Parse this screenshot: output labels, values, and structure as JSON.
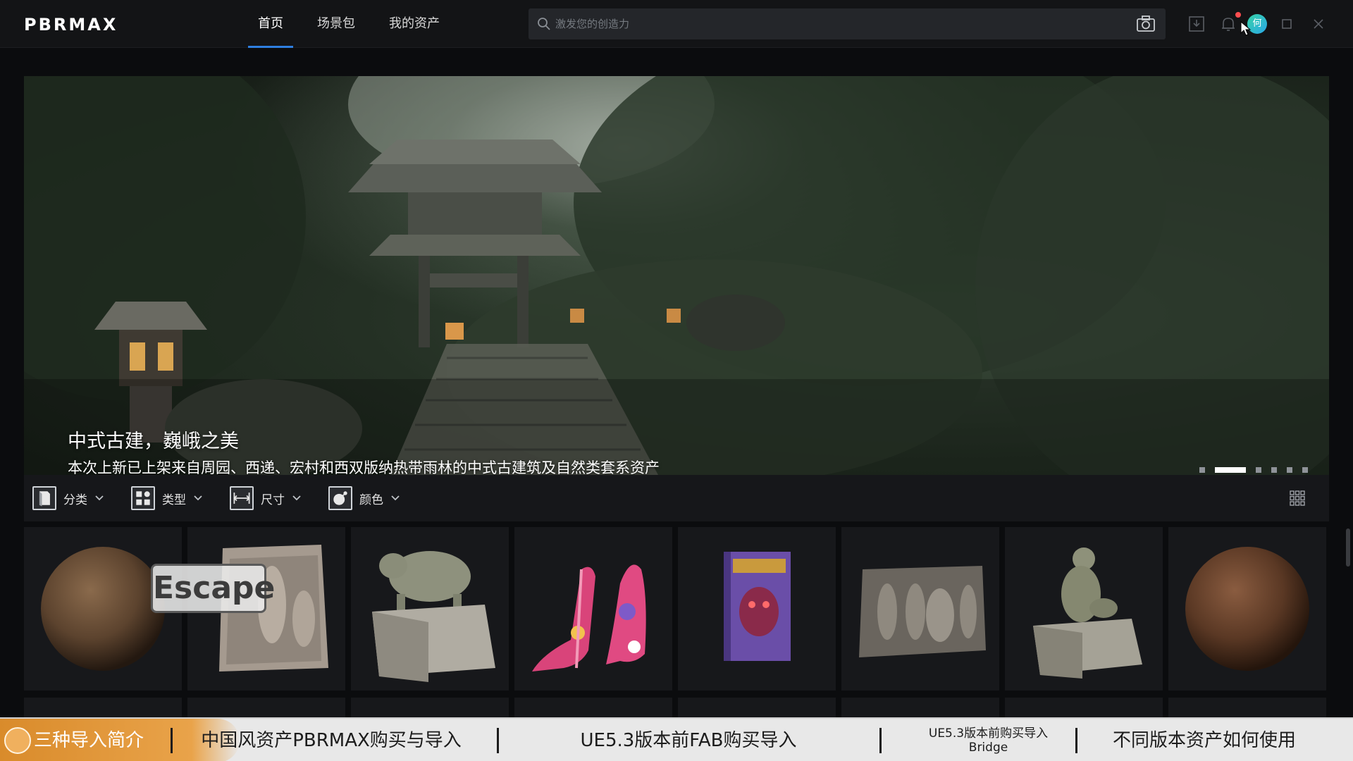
{
  "app": {
    "logo_text": "PBRMAX"
  },
  "nav": {
    "items": [
      {
        "label": "首页",
        "active": true
      },
      {
        "label": "场景包",
        "active": false
      },
      {
        "label": "我的资产",
        "active": false
      }
    ]
  },
  "search": {
    "placeholder": "激发您的创造力",
    "value": ""
  },
  "user": {
    "avatar_text": "何"
  },
  "banner": {
    "title": "中式古建，巍峨之美",
    "subtitle": "本次上新已上架来自周园、西递、宏村和西双版纳热带雨林的中式古建筑及自然类套系资产",
    "slide_count": 6,
    "active_slide": 2
  },
  "filters": [
    {
      "label": "分类",
      "icon": "book-icon"
    },
    {
      "label": "类型",
      "icon": "grid-type-icon"
    },
    {
      "label": "尺寸",
      "icon": "ruler-icon"
    },
    {
      "label": "颜色",
      "icon": "palette-icon"
    }
  ],
  "assets": [
    {
      "name": "wood-sphere-material",
      "icon": "material-sphere-icon"
    },
    {
      "name": "buddha-stone-relief",
      "icon": "stone-relief-icon"
    },
    {
      "name": "stone-pig-statue",
      "icon": "pig-statue-icon"
    },
    {
      "name": "floral-high-heels",
      "icon": "high-heel-icon"
    },
    {
      "name": "violator-book",
      "icon": "book-cover-icon"
    },
    {
      "name": "buddha-carving-panel",
      "icon": "carving-panel-icon"
    },
    {
      "name": "monkey-stone-statue",
      "icon": "monkey-statue-icon"
    },
    {
      "name": "soil-sphere-material",
      "icon": "material-sphere-icon"
    }
  ],
  "overlay": {
    "escape_label": "Escape"
  },
  "tutorial_strip": {
    "items": [
      {
        "label": "三种导入简介"
      },
      {
        "label": "中国风资产PBRMAX购买与导入"
      },
      {
        "label": "UE5.3版本前FAB购买导入"
      },
      {
        "line1": "UE5.3版本前购买导入",
        "line2": "Bridge"
      },
      {
        "label": "不同版本资产如何使用"
      }
    ]
  },
  "colors": {
    "accent": "#2f7fe0",
    "topbar_bg": "#131416",
    "page_bg": "#0b0c0e",
    "notification_dot": "#ff4d4f",
    "tutorial_highlight": "#e9a34a"
  }
}
